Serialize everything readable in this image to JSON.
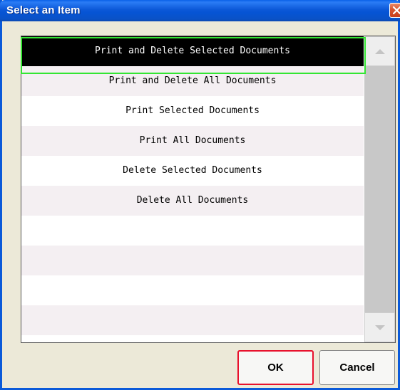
{
  "window": {
    "title": "Select an Item"
  },
  "list": {
    "items": [
      {
        "label": "Print and Delete Selected Documents",
        "selected": true
      },
      {
        "label": "Print and Delete All Documents",
        "selected": false
      },
      {
        "label": "Print Selected Documents",
        "selected": false
      },
      {
        "label": "Print All Documents",
        "selected": false
      },
      {
        "label": "Delete Selected Documents",
        "selected": false
      },
      {
        "label": "Delete All Documents",
        "selected": false
      },
      {
        "label": "",
        "selected": false
      },
      {
        "label": "",
        "selected": false
      },
      {
        "label": "",
        "selected": false
      },
      {
        "label": "",
        "selected": false
      }
    ]
  },
  "buttons": {
    "ok_label": "OK",
    "cancel_label": "Cancel"
  },
  "colors": {
    "titlebar": "#0a52c6",
    "selection": "#000000",
    "focus_ring": "#33e633",
    "ok_highlight": "#e8112d",
    "row_alt": "#f4eff2"
  },
  "icons": {
    "close": "close-icon",
    "scroll_up": "arrow-up-icon",
    "scroll_down": "arrow-down-icon"
  }
}
